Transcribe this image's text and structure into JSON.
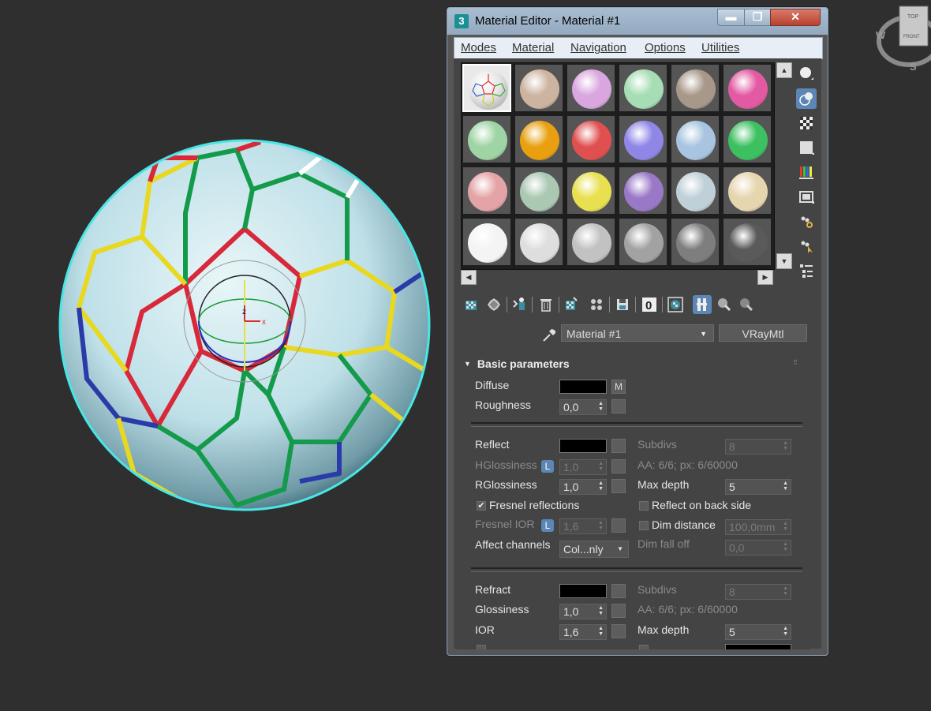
{
  "window": {
    "app_icon": "3",
    "title": "Material Editor - Material #1",
    "minimize_glyph": "▬",
    "maximize_glyph": "❐",
    "close_glyph": "✕"
  },
  "menu": [
    "Modes",
    "Material",
    "Navigation",
    "Options",
    "Utilities"
  ],
  "samples": {
    "colors": [
      "soccer",
      "#cdb4a0",
      "#d9a6df",
      "#a6ddb4",
      "#a8988a",
      "#e35aa3",
      "#9fd4a4",
      "#e8a010",
      "#e05050",
      "#8f86e6",
      "#a8c4e0",
      "#3cc060",
      "#e4a3a6",
      "#aac8b2",
      "#e8e050",
      "#9a78c8",
      "#c0d0d8",
      "#e6d6b0",
      "#f4f4f4",
      "#dedede",
      "#c2c2c2",
      "#a2a2a2",
      "#7e7e7e",
      "#5a5a5a"
    ]
  },
  "scroll": {
    "up": "▲",
    "down": "▼",
    "left": "◀",
    "right": "▶"
  },
  "material": {
    "name": "Material #1",
    "type": "VRayMtl"
  },
  "params": {
    "rollout_title": "Basic parameters",
    "diffuse": {
      "label": "Diffuse",
      "map_button": "M"
    },
    "roughness": {
      "label": "Roughness",
      "value": "0,0"
    },
    "reflect": {
      "label": "Reflect"
    },
    "hglossiness": {
      "label": "HGlossiness",
      "lock": "L",
      "value": "1,0"
    },
    "rglossiness": {
      "label": "RGlossiness",
      "value": "1,0"
    },
    "fresnel": {
      "label": "Fresnel reflections",
      "checked": true
    },
    "fresnel_ior": {
      "label": "Fresnel IOR",
      "lock": "L",
      "value": "1,6"
    },
    "affect_channels": {
      "label": "Affect channels",
      "value": "Col...nly"
    },
    "refl_subdivs": {
      "label": "Subdivs",
      "value": "8"
    },
    "refl_aa": "AA: 6/6; px: 6/60000",
    "refl_max_depth": {
      "label": "Max depth",
      "value": "5"
    },
    "reflect_back": {
      "label": "Reflect on back side"
    },
    "dim_distance": {
      "label": "Dim distance",
      "value": "100,0mm"
    },
    "dim_falloff": {
      "label": "Dim fall off",
      "value": "0,0"
    },
    "refract": {
      "label": "Refract"
    },
    "glossiness": {
      "label": "Glossiness",
      "value": "1,0"
    },
    "ior": {
      "label": "IOR",
      "value": "1,6"
    },
    "refr_subdivs": {
      "label": "Subdivs",
      "value": "8"
    },
    "refr_aa": "AA: 6/6; px: 6/60000",
    "refr_max_depth": {
      "label": "Max depth",
      "value": "5"
    }
  },
  "viewcube": {
    "top": "TOP",
    "front": "FRONT",
    "w": "W",
    "s": "S"
  },
  "gizmo": {
    "z": "z",
    "x": "x"
  },
  "colors": {
    "selection": "#49e6e6",
    "accent": "#5c86b6"
  }
}
